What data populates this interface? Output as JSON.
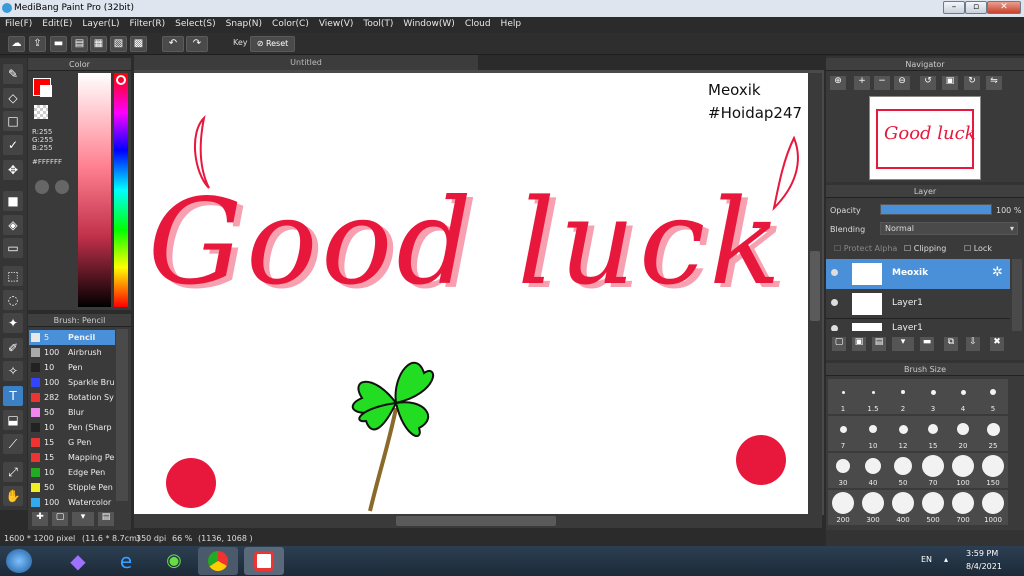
{
  "window": {
    "title": "MediBang Paint Pro (32bit)"
  },
  "menu": [
    "File(F)",
    "Edit(E)",
    "Layer(L)",
    "Filter(R)",
    "Select(S)",
    "Snap(N)",
    "Color(C)",
    "View(V)",
    "Tool(T)",
    "Window(W)",
    "Cloud",
    "Help"
  ],
  "toolbar": {
    "key_label": "Key",
    "reset_label": "Reset"
  },
  "color_panel": {
    "title": "Color",
    "r": "R:255",
    "g": "G:255",
    "b": "B:255",
    "hex": "#FFFFFF",
    "primary": "#ff0000",
    "secondary": "#ffffff"
  },
  "brush_panel": {
    "title": "Brush: Pencil",
    "items": [
      {
        "size": "5",
        "name": "Pencil",
        "color": "#e8e8e8"
      },
      {
        "size": "100",
        "name": "Airbrush",
        "color": "#aaaaaa"
      },
      {
        "size": "10",
        "name": "Pen",
        "color": "#222222"
      },
      {
        "size": "100",
        "name": "Sparkle Bru",
        "color": "#3344ff"
      },
      {
        "size": "282",
        "name": "Rotation Sy",
        "color": "#ee3333"
      },
      {
        "size": "50",
        "name": "Blur",
        "color": "#ee88ee"
      },
      {
        "size": "10",
        "name": "Pen (Sharp",
        "color": "#222222"
      },
      {
        "size": "15",
        "name": "G Pen",
        "color": "#ee3333"
      },
      {
        "size": "15",
        "name": "Mapping Pe",
        "color": "#ee3333"
      },
      {
        "size": "10",
        "name": "Edge Pen",
        "color": "#22aa22"
      },
      {
        "size": "50",
        "name": "Stipple Pen",
        "color": "#eeee22"
      },
      {
        "size": "100",
        "name": "Watercolor",
        "color": "#33aaee"
      }
    ]
  },
  "document": {
    "tab_title": "Untitled"
  },
  "canvas": {
    "signature": "Meoxik",
    "hashtag": "#Hoidap247",
    "artwork_text": "Good luck"
  },
  "status": {
    "dimensions": "1600 * 1200 pixel",
    "size_cm": "(11.6 * 8.7cm)",
    "dpi": "350 dpi",
    "zoom": "66 %",
    "cursor": "(1136, 1068 )"
  },
  "navigator": {
    "title": "Navigator"
  },
  "layer_panel": {
    "title": "Layer",
    "opacity_label": "Opacity",
    "opacity_value": "100 %",
    "opacity": 1.0,
    "blending_label": "Blending",
    "blending_value": "Normal",
    "protect_alpha": "Protect Alpha",
    "clipping": "Clipping",
    "lock": "Lock",
    "layers": [
      {
        "name": "Meoxik",
        "selected": true
      },
      {
        "name": "Layer1",
        "selected": false
      },
      {
        "name": "Layer1",
        "selected": false
      }
    ]
  },
  "brush_size": {
    "title": "Brush Size",
    "sizes": [
      "1",
      "1.5",
      "2",
      "3",
      "4",
      "5",
      "7",
      "10",
      "12",
      "15",
      "20",
      "25",
      "30",
      "40",
      "50",
      "70",
      "100",
      "150",
      "200",
      "300",
      "400",
      "500",
      "700",
      "1000"
    ]
  },
  "taskbar": {
    "language": "EN",
    "time": "3:59 PM",
    "date": "8/4/2021"
  },
  "colors": {
    "accent_blue": "#4a90d9",
    "canvas_red": "#e8173c",
    "clover_green": "#22dd22"
  }
}
